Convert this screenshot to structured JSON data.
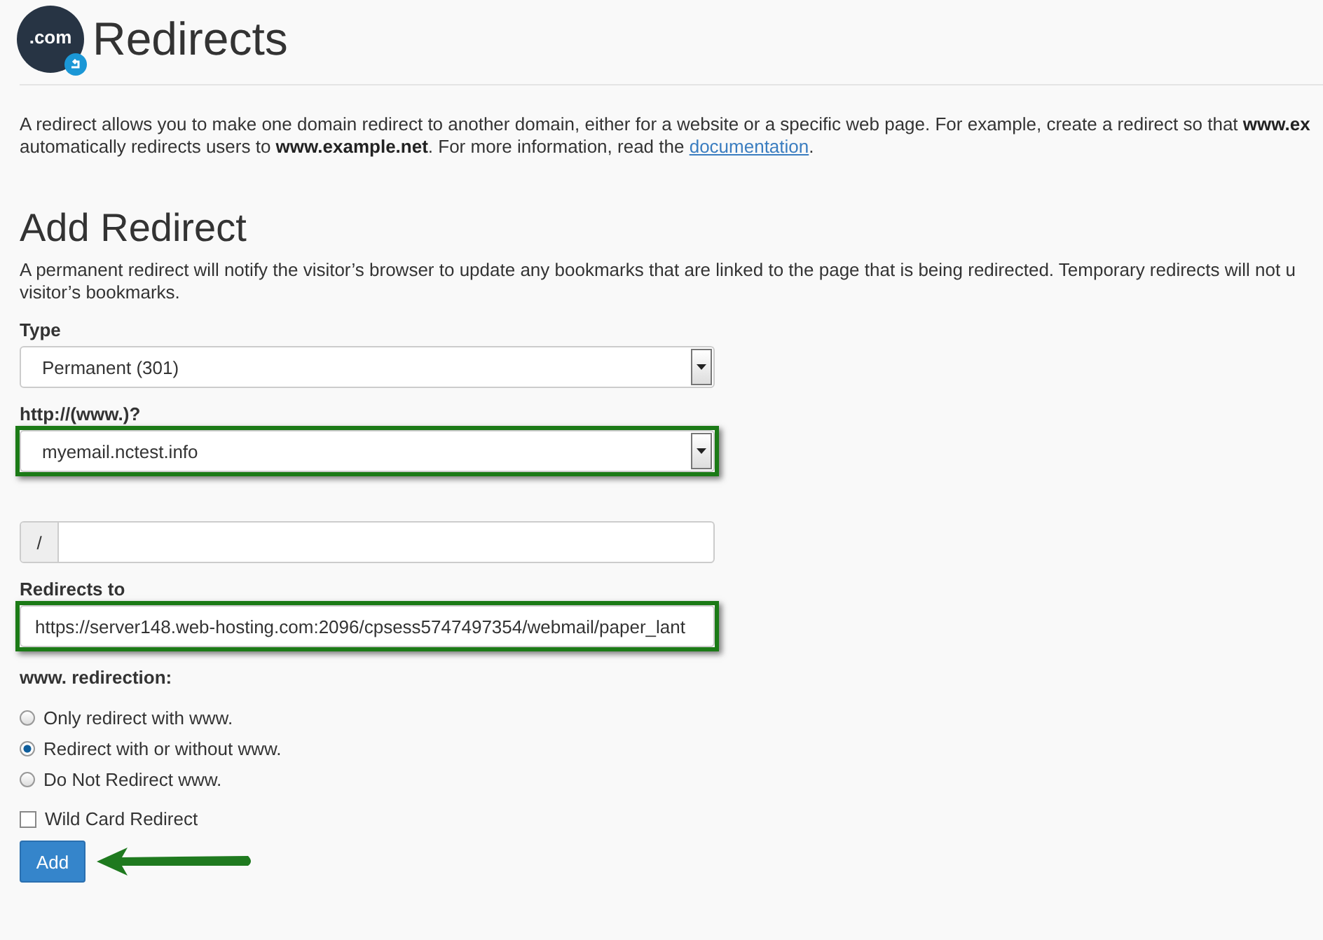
{
  "header": {
    "logo_text": ".com",
    "title": "Redirects"
  },
  "intro": {
    "lines": [
      "A redirect allows you to make one domain redirect to another domain, either for a website or a specific web page. For example, create a redirect so that **www.ex**",
      "automatically redirects users to **www.example.net**. For more information, read the"
    ],
    "link": "documentation",
    "tail": "."
  },
  "section": {
    "title": "Add Redirect",
    "lines": [
      "A permanent redirect will notify the visitor’s browser to update any bookmarks that are linked to the page that is being redirected. Temporary redirects will not u",
      "visitor’s bookmarks."
    ]
  },
  "fields": [
    {
      "kind": "select",
      "label": "Type",
      "value": "Permanent (301)",
      "highlighted": false
    },
    {
      "kind": "select",
      "label": "http://(www.)?",
      "value": "myemail.nctest.info",
      "highlighted": true
    },
    {
      "kind": "path",
      "prefix": "/",
      "highlighted": false
    },
    {
      "kind": "text",
      "label": "Redirects to",
      "value": "https://server148.web-hosting.com:2096/cpsess5747497354/webmail/paper_lant",
      "highlighted": true
    }
  ],
  "www_redirection": {
    "label": "www. redirection:",
    "options": [
      {
        "label": "Only redirect with www.",
        "selected": false
      },
      {
        "label": "Redirect with or without www.",
        "selected": true
      },
      {
        "label": "Do Not Redirect www.",
        "selected": false
      }
    ]
  },
  "wildcard": {
    "label": "Wild Card Redirect",
    "checked": false
  },
  "add_button": {
    "label": "Add",
    "annotated": true
  }
}
